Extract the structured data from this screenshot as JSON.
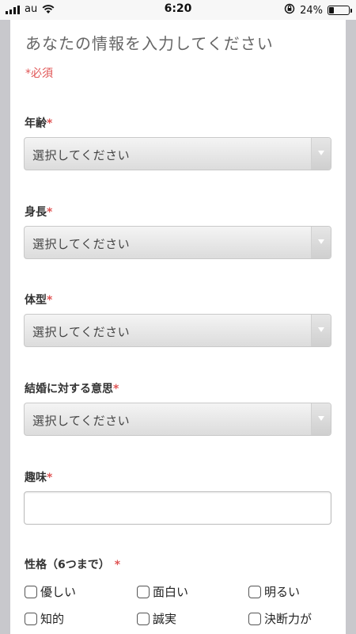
{
  "status_bar": {
    "carrier": "au",
    "time": "6:20",
    "battery_percent": "24%",
    "battery_level": 0.24,
    "icons": [
      "signal-icon",
      "wifi-icon",
      "orientation-lock-icon",
      "battery-icon"
    ]
  },
  "form": {
    "title": "あなたの情報を入力してください",
    "required_note": "*必須",
    "required_mark": "*",
    "accent_color": "#e05555",
    "fields": [
      {
        "label": "年齢",
        "type": "select",
        "value": "選択してください"
      },
      {
        "label": "身長",
        "type": "select",
        "value": "選択してください"
      },
      {
        "label": "体型",
        "type": "select",
        "value": "選択してください"
      },
      {
        "label": "結婚に対する意思",
        "type": "select",
        "value": "選択してください"
      },
      {
        "label": "趣味",
        "type": "text",
        "value": ""
      },
      {
        "label": "性格（6つまで）",
        "type": "checkbox-group",
        "options": [
          "優しい",
          "面白い",
          "明るい",
          "知的",
          "誠実",
          "決断力が"
        ]
      }
    ]
  }
}
